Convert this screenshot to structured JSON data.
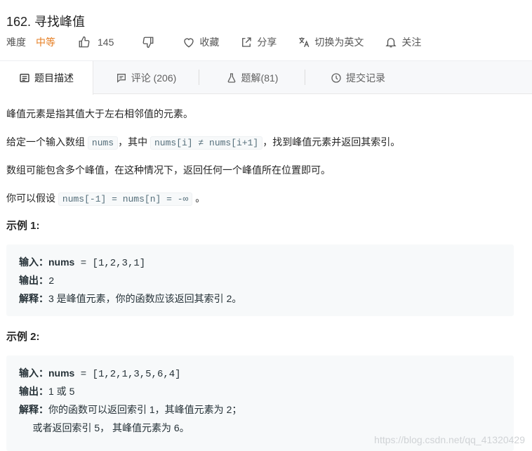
{
  "problem": {
    "title": "162. 寻找峰值",
    "difficulty_label": "难度",
    "difficulty": "中等",
    "likes": "145",
    "collect": "收藏",
    "share": "分享",
    "translate": "切换为英文",
    "follow": "关注"
  },
  "tabs": [
    {
      "label": "题目描述"
    },
    {
      "label": "评论 (206)"
    },
    {
      "label": "题解(81)"
    },
    {
      "label": "提交记录"
    }
  ],
  "description": {
    "p1": "峰值元素是指其值大于左右相邻值的元素。",
    "p2_a": "给定一个输入数组",
    "p2_code1": "nums",
    "p2_b": "，其中",
    "p2_code2": "nums[i] ≠ nums[i+1]",
    "p2_c": "，找到峰值元素并返回其索引。",
    "p3": "数组可能包含多个峰值，在这种情况下，返回任何一个峰值所在位置即可。",
    "p4_a": "你可以假设",
    "p4_code": "nums[-1] = nums[n] = -∞",
    "p4_b": "。"
  },
  "examples": [
    {
      "heading": "示例 1:",
      "input_label": "输入：",
      "input_var": "nums",
      "input_rest": " = [1,2,3,1]",
      "output_label": "输出：",
      "output": "2",
      "explain_label": "解释：",
      "explain_lines": [
        "3 是峰值元素，你的函数应该返回其索引 2。"
      ]
    },
    {
      "heading": "示例 2:",
      "input_label": "输入：",
      "input_var": "nums",
      "input_rest": " = [1,2,1,3,5,6,4]",
      "output_label": "输出：",
      "output": "1 或 5",
      "explain_label": "解释：",
      "explain_lines": [
        "你的函数可以返回索引 1，其峰值元素为 2；",
        "     或者返回索引 5， 其峰值元素为 6。"
      ]
    }
  ],
  "watermark": "https://blog.csdn.net/qq_41320429",
  "colors": {
    "difficulty": "#e67e22",
    "tab_bar": "#f7f8fa",
    "code_bg": "#f7f9fa"
  }
}
